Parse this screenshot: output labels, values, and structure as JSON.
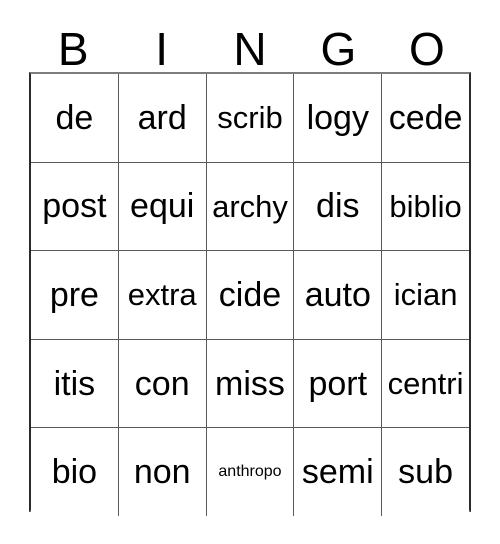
{
  "card": {
    "title": "BINGO",
    "header_letters": [
      "B",
      "I",
      "N",
      "G",
      "O"
    ],
    "colors": {
      "text": "#000000",
      "background": "#ffffff",
      "grid_line": "#5a5a5a",
      "outer_border_dark": "#2b2b2b",
      "outer_border_light": "#7d7d7d"
    },
    "grid": {
      "columns": 5,
      "rows": 5,
      "cells": [
        [
          {
            "text": "de",
            "size": "normal"
          },
          {
            "text": "ard",
            "size": "normal"
          },
          {
            "text": "scrib",
            "size": "small"
          },
          {
            "text": "logy",
            "size": "normal"
          },
          {
            "text": "cede",
            "size": "normal"
          }
        ],
        [
          {
            "text": "post",
            "size": "normal"
          },
          {
            "text": "equi",
            "size": "normal"
          },
          {
            "text": "archy",
            "size": "small"
          },
          {
            "text": "dis",
            "size": "normal"
          },
          {
            "text": "biblio",
            "size": "small"
          }
        ],
        [
          {
            "text": "pre",
            "size": "normal"
          },
          {
            "text": "extra",
            "size": "small"
          },
          {
            "text": "cide",
            "size": "normal"
          },
          {
            "text": "auto",
            "size": "normal"
          },
          {
            "text": "ician",
            "size": "small"
          }
        ],
        [
          {
            "text": "itis",
            "size": "normal"
          },
          {
            "text": "con",
            "size": "normal"
          },
          {
            "text": "miss",
            "size": "normal"
          },
          {
            "text": "port",
            "size": "normal"
          },
          {
            "text": "centri",
            "size": "small"
          }
        ],
        [
          {
            "text": "bio",
            "size": "normal"
          },
          {
            "text": "non",
            "size": "normal"
          },
          {
            "text": "anthropo",
            "size": "tiny"
          },
          {
            "text": "semi",
            "size": "normal"
          },
          {
            "text": "sub",
            "size": "normal"
          }
        ]
      ]
    }
  }
}
